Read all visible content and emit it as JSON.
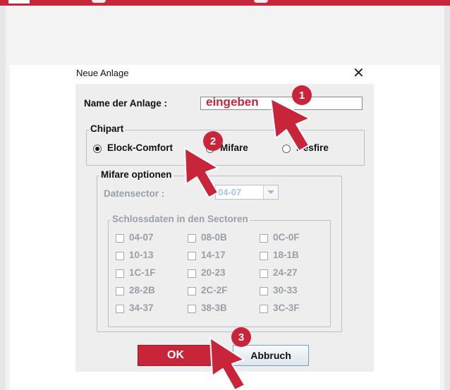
{
  "dialog": {
    "title": "Neue Anlage",
    "close_glyph": "✕",
    "name_label": "Name der Anlage :",
    "name_value": "eingeben",
    "chipart": {
      "legend": "Chipart",
      "options": [
        "Elock-Comfort",
        "Mifare",
        "Desfire"
      ],
      "selected": "Elock-Comfort"
    },
    "mifare": {
      "legend": "Mifare optionen",
      "datensector_label": "Datensector :",
      "datensector_value": "04-07",
      "schloss_legend": "Schlossdaten in den Sectoren",
      "sectors": [
        "04-07",
        "08-0B",
        "0C-0F",
        "10-13",
        "14-17",
        "18-1B",
        "1C-1F",
        "20-23",
        "24-27",
        "28-2B",
        "2C-2F",
        "30-33",
        "34-37",
        "38-3B",
        "3C-3F"
      ]
    },
    "ok_label": "OK",
    "cancel_label": "Abbruch"
  },
  "markers": [
    "1",
    "2",
    "3"
  ],
  "colors": {
    "accent": "#c8253b",
    "disabled_text": "#9aa0a8",
    "group_border": "#b9c1cc"
  },
  "icons": {
    "close": "close-icon",
    "combo": "chevron-down-icon",
    "annotation": "arrow-pointer-icon"
  }
}
